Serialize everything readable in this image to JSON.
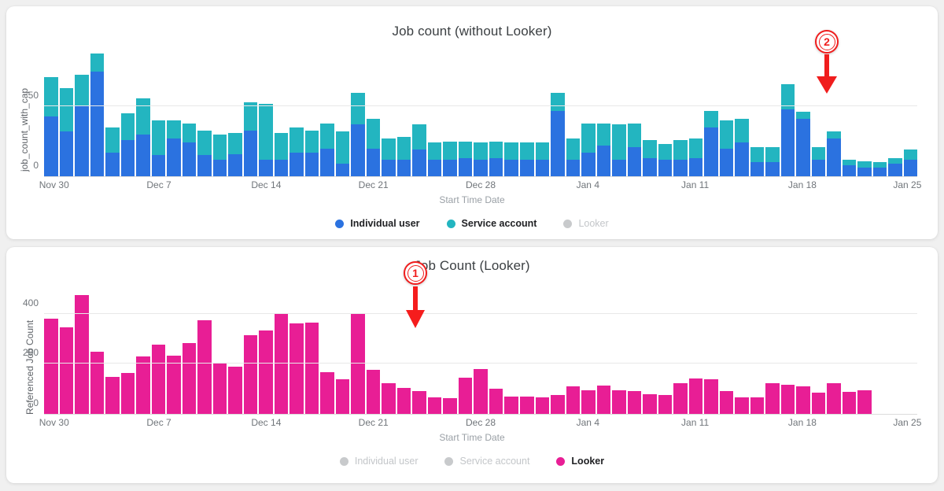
{
  "charts": [
    {
      "id": "job-count-without-looker",
      "title": "Job count (without Looker)",
      "ylabel": "job_count_with_cap",
      "xlabel": "Start Time Date",
      "yticks": [
        "0",
        "50"
      ],
      "xticks": [
        "Nov 30",
        "Dec 7",
        "Dec 14",
        "Dec 21",
        "Dec 28",
        "Jan 4",
        "Jan 11",
        "Jan 18",
        "Jan 25"
      ],
      "legend": [
        {
          "label": "Individual user",
          "color": "#2b72e0",
          "active": true
        },
        {
          "label": "Service account",
          "color": "#23b5c0",
          "active": true
        },
        {
          "label": "Looker",
          "color": "#c8cacc",
          "active": false
        }
      ],
      "annotation": {
        "number": "2",
        "color": "#f01d1d"
      }
    },
    {
      "id": "job-count-looker",
      "title": "Job Count (Looker)",
      "ylabel": "Referenced Job Count",
      "xlabel": "Start Time Date",
      "yticks": [
        "0",
        "200",
        "400"
      ],
      "xticks": [
        "Nov 30",
        "Dec 7",
        "Dec 14",
        "Dec 21",
        "Dec 28",
        "Jan 4",
        "Jan 11",
        "Jan 18",
        "Jan 25"
      ],
      "legend": [
        {
          "label": "Individual user",
          "color": "#c8cacc",
          "active": false
        },
        {
          "label": "Service account",
          "color": "#c8cacc",
          "active": false
        },
        {
          "label": "Looker",
          "color": "#e81e95",
          "active": true
        }
      ],
      "annotation": {
        "number": "1",
        "color": "#f01d1d"
      }
    }
  ],
  "chart_data": [
    {
      "type": "bar",
      "stacked": true,
      "title": "Job count (without Looker)",
      "xlabel": "Start Time Date",
      "ylabel": "job_count_with_cap",
      "ylim": [
        0,
        88
      ],
      "yticks": [
        0,
        50
      ],
      "grid": true,
      "legend_position": "bottom",
      "categories": [
        "Nov 30",
        "Dec 1",
        "Dec 2",
        "Dec 3",
        "Dec 4",
        "Dec 5",
        "Dec 6",
        "Dec 7",
        "Dec 8",
        "Dec 9",
        "Dec 10",
        "Dec 11",
        "Dec 12",
        "Dec 13",
        "Dec 14",
        "Dec 15",
        "Dec 16",
        "Dec 17",
        "Dec 18",
        "Dec 19",
        "Dec 20",
        "Dec 21",
        "Dec 22",
        "Dec 23",
        "Dec 24",
        "Dec 25",
        "Dec 26",
        "Dec 27",
        "Dec 28",
        "Dec 29",
        "Dec 30",
        "Dec 31",
        "Jan 1",
        "Jan 2",
        "Jan 3",
        "Jan 4",
        "Jan 5",
        "Jan 6",
        "Jan 7",
        "Jan 8",
        "Jan 9",
        "Jan 10",
        "Jan 11",
        "Jan 12",
        "Jan 13",
        "Jan 14",
        "Jan 15",
        "Jan 16",
        "Jan 17",
        "Jan 18",
        "Jan 19",
        "Jan 20",
        "Jan 21",
        "Jan 22",
        "Jan 23",
        "Jan 24",
        "Jan 25"
      ],
      "series": [
        {
          "name": "Individual user",
          "color": "#2b72e0",
          "values": [
            43,
            32,
            51,
            75,
            17,
            26,
            30,
            15,
            27,
            24,
            15,
            12,
            16,
            33,
            12,
            12,
            17,
            17,
            20,
            9,
            37,
            20,
            12,
            12,
            19,
            12,
            12,
            13,
            12,
            13,
            12,
            12,
            12,
            47,
            12,
            17,
            22,
            12,
            21,
            13,
            12,
            12,
            13,
            35,
            20,
            24,
            10,
            10,
            48,
            41,
            12,
            27,
            8,
            6,
            6,
            9,
            12
          ]
        },
        {
          "name": "Service account",
          "color": "#23b5c0",
          "values": [
            28,
            31,
            22,
            13,
            18,
            19,
            26,
            25,
            13,
            14,
            18,
            18,
            15,
            20,
            40,
            19,
            18,
            16,
            18,
            23,
            23,
            21,
            15,
            16,
            18,
            12,
            13,
            12,
            12,
            12,
            12,
            12,
            12,
            13,
            15,
            21,
            16,
            25,
            17,
            13,
            11,
            14,
            14,
            12,
            20,
            17,
            11,
            11,
            18,
            5,
            9,
            5,
            4,
            5,
            4,
            4,
            7
          ]
        },
        {
          "name": "Looker",
          "color": "#c8cacc",
          "values": []
        }
      ]
    },
    {
      "type": "bar",
      "stacked": false,
      "title": "Job Count (Looker)",
      "xlabel": "Start Time Date",
      "ylabel": "Referenced Job Count",
      "ylim": [
        0,
        490
      ],
      "yticks": [
        0,
        200,
        400
      ],
      "grid": true,
      "legend_position": "bottom",
      "categories": [
        "Nov 30",
        "Dec 1",
        "Dec 2",
        "Dec 3",
        "Dec 4",
        "Dec 5",
        "Dec 6",
        "Dec 7",
        "Dec 8",
        "Dec 9",
        "Dec 10",
        "Dec 11",
        "Dec 12",
        "Dec 13",
        "Dec 14",
        "Dec 15",
        "Dec 16",
        "Dec 17",
        "Dec 18",
        "Dec 19",
        "Dec 20",
        "Dec 21",
        "Dec 22",
        "Dec 23",
        "Dec 24",
        "Dec 25",
        "Dec 26",
        "Dec 27",
        "Dec 28",
        "Dec 29",
        "Dec 30",
        "Dec 31",
        "Jan 1",
        "Jan 2",
        "Jan 3",
        "Jan 4",
        "Jan 5",
        "Jan 6",
        "Jan 7",
        "Jan 8",
        "Jan 9",
        "Jan 10",
        "Jan 11",
        "Jan 12",
        "Jan 13",
        "Jan 14",
        "Jan 15",
        "Jan 16",
        "Jan 17",
        "Jan 18",
        "Jan 19",
        "Jan 20",
        "Jan 21",
        "Jan 22",
        "Jan 23",
        "Jan 24",
        "Jan 25"
      ],
      "series": [
        {
          "name": "Looker",
          "color": "#e81e95",
          "values": [
            380,
            345,
            475,
            248,
            148,
            162,
            228,
            278,
            232,
            283,
            375,
            205,
            190,
            315,
            333,
            400,
            360,
            363,
            168,
            138,
            403,
            175,
            123,
            103,
            90,
            65,
            63,
            145,
            178,
            100,
            70,
            68,
            65,
            75,
            110,
            95,
            112,
            95,
            92,
            78,
            75,
            122,
            140,
            138,
            92,
            65,
            66,
            123,
            115,
            110,
            85,
            122,
            88,
            95
          ]
        }
      ]
    }
  ]
}
